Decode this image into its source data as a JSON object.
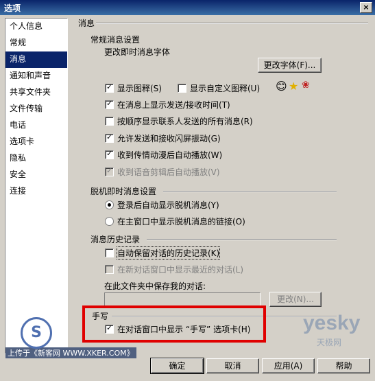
{
  "window": {
    "title": "选项",
    "close": "×"
  },
  "sidebar": {
    "items": [
      {
        "label": "个人信息"
      },
      {
        "label": "常规"
      },
      {
        "label": "消息"
      },
      {
        "label": "通知和声音"
      },
      {
        "label": "共享文件夹"
      },
      {
        "label": "文件传输"
      },
      {
        "label": "电话"
      },
      {
        "label": "选项卡"
      },
      {
        "label": "隐私"
      },
      {
        "label": "安全"
      },
      {
        "label": "连接"
      }
    ],
    "active_index": 2
  },
  "main": {
    "section_title": "消息",
    "instant": {
      "header": "常规消息设置",
      "font_label": "更改即时消息字体",
      "font_button": "更改字体(F)...",
      "options": [
        {
          "label": "显示图释(S)",
          "checked": true
        },
        {
          "label": "显示自定义图释(U)",
          "checked": false
        },
        {
          "label": "在消息上显示发送/接收时间(T)",
          "checked": true
        },
        {
          "label": "按顺序显示联系人发送的所有消息(R)",
          "checked": false
        },
        {
          "label": "允许发送和接收闪屏振动(G)",
          "checked": true
        },
        {
          "label": "收到传情动漫后自动播放(W)",
          "checked": true
        },
        {
          "label": "收到语音剪辑后自动播放(V)",
          "checked": true,
          "disabled": true
        }
      ]
    },
    "offline": {
      "header": "脱机即时消息设置",
      "radios": [
        {
          "label": "登录后自动显示脱机消息(Y)",
          "selected": true
        },
        {
          "label": "在主窗口中显示脱机消息的链接(O)",
          "selected": false
        }
      ]
    },
    "history": {
      "header": "消息历史记录",
      "options": [
        {
          "label": "自动保留对话的历史记录(K)",
          "checked": false
        },
        {
          "label": "在新对话窗口中显示最近的对话(L)",
          "checked": false,
          "disabled": true
        }
      ],
      "folder_label": "在此文件夹中保存我的对话:",
      "change_button": "更改(N)..."
    },
    "handwriting": {
      "header": "手写",
      "option": {
        "label": "在对话窗口中显示 “手写” 选项卡(H)",
        "checked": true
      }
    }
  },
  "footer": {
    "ok": "确定",
    "cancel": "取消",
    "apply": "应用(A)",
    "help": "帮助"
  },
  "watermark": {
    "upload_text": "上传于《新客网 WWW.XKER.COM》",
    "brand": "yesky",
    "brand_sub": "天极网"
  },
  "colors": {
    "title_bar": "#0a246a",
    "highlight_box": "#e00000"
  }
}
